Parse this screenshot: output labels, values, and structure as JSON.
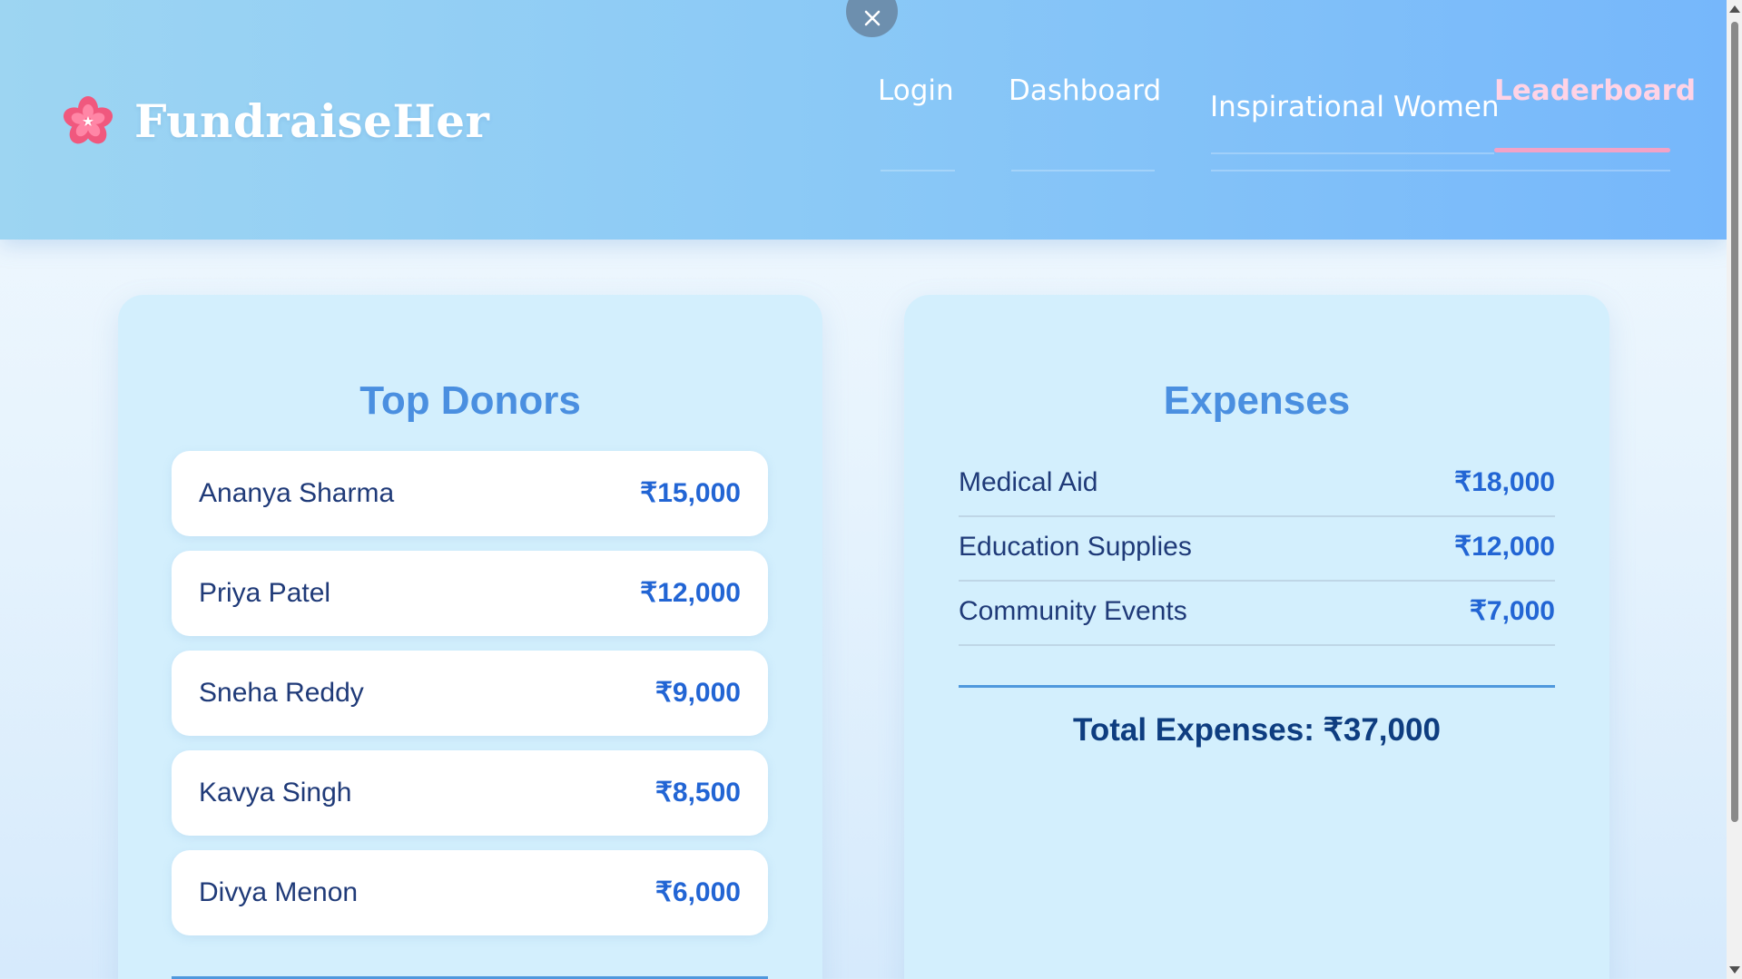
{
  "app": {
    "brand_name": "FundraiseHer",
    "brand_icon": "cherry-blossom-icon"
  },
  "nav": {
    "close_icon": "close-icon",
    "items": [
      {
        "label": "Login"
      },
      {
        "label": "Dashboard"
      },
      {
        "label": "Inspirational Women"
      },
      {
        "label": "Leaderboard",
        "active": true
      }
    ]
  },
  "donors": {
    "title": "Top Donors",
    "items": [
      {
        "name": "Ananya Sharma",
        "amount": "₹15,000"
      },
      {
        "name": "Priya Patel",
        "amount": "₹12,000"
      },
      {
        "name": "Sneha Reddy",
        "amount": "₹9,000"
      },
      {
        "name": "Kavya Singh",
        "amount": "₹8,500"
      },
      {
        "name": "Divya Menon",
        "amount": "₹6,000"
      }
    ]
  },
  "expenses": {
    "title": "Expenses",
    "items": [
      {
        "name": "Medical Aid",
        "amount": "₹18,000"
      },
      {
        "name": "Education Supplies",
        "amount": "₹12,000"
      },
      {
        "name": "Community Events",
        "amount": "₹7,000"
      }
    ],
    "total_label": "Total Expenses:",
    "total_value": "₹37,000"
  },
  "colors": {
    "header_start": "#9dd5f2",
    "header_end": "#76b7fb",
    "card_bg": "#d3effd",
    "title_blue": "#4a8fe0",
    "amount_blue": "#2265d4",
    "active_nav_pink": "#ffd3e6",
    "active_underline": "#f3a2c6"
  }
}
